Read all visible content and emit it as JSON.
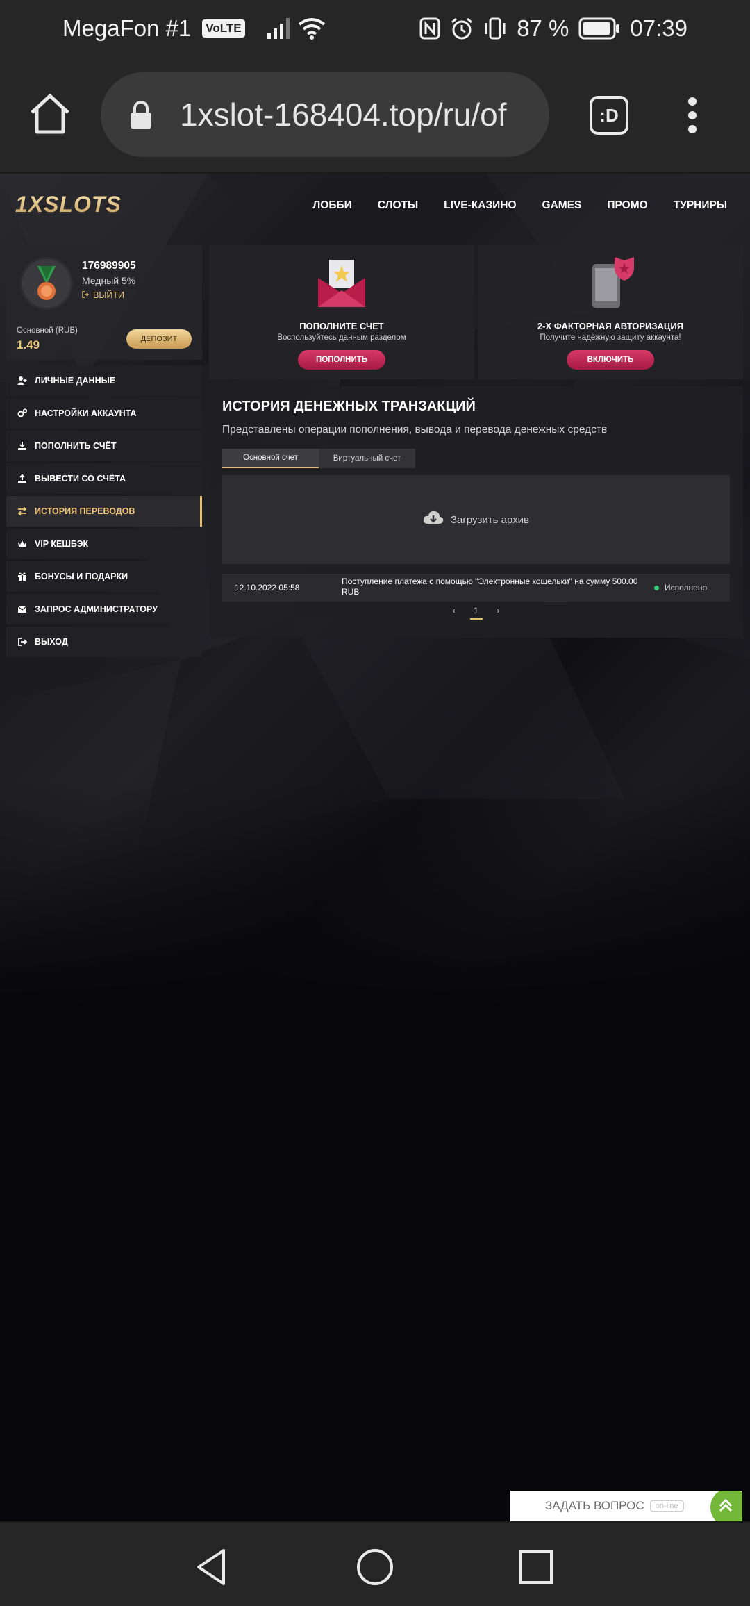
{
  "status_bar": {
    "carrier": "MegaFon #1",
    "volte": "VoLTE",
    "battery": "87 %",
    "time": "07:39"
  },
  "browser": {
    "url": "1xslot-168404.top/ru/of",
    "tabs_label": ":D"
  },
  "site": {
    "logo": "1XSLOTS",
    "nav": [
      "ЛОББИ",
      "СЛОТЫ",
      "LIVE-КАЗИНО",
      "GAMES",
      "ПРОМО",
      "ТУРНИРЫ"
    ]
  },
  "profile": {
    "user_id": "176989905",
    "level": "Медный 5%",
    "logout": "ВЫЙТИ",
    "balance_label": "Основной (RUB)",
    "balance": "1.49",
    "deposit": "ДЕПОЗИТ"
  },
  "side_menu": [
    {
      "label": "ЛИЧНЫЕ ДАННЫЕ",
      "icon": "user-plus-icon"
    },
    {
      "label": "НАСТРОЙКИ АККАУНТА",
      "icon": "gears-icon"
    },
    {
      "label": "ПОПОЛНИТЬ СЧЁТ",
      "icon": "download-icon"
    },
    {
      "label": "ВЫВЕСТИ СО СЧЁТА",
      "icon": "upload-icon"
    },
    {
      "label": "ИСТОРИЯ ПЕРЕВОДОВ",
      "icon": "transfer-icon",
      "active": true
    },
    {
      "label": "VIP КЕШБЭК",
      "icon": "crown-icon"
    },
    {
      "label": "БОНУСЫ И ПОДАРКИ",
      "icon": "gift-icon"
    },
    {
      "label": "ЗАПРОС АДМИНИСТРАТОРУ",
      "icon": "envelope-icon"
    },
    {
      "label": "ВЫХОД",
      "icon": "logout-icon"
    }
  ],
  "cards": {
    "deposit": {
      "title": "ПОПОЛНИТЕ СЧЕТ",
      "subtitle": "Воспользуйтесь данным разделом",
      "button": "ПОПОЛНИТЬ"
    },
    "twofa": {
      "title": "2-Х ФАКТОРНАЯ АВТОРИЗАЦИЯ",
      "subtitle": "Получите надёжную защиту аккаунта!",
      "button": "ВКЛЮЧИТЬ"
    }
  },
  "transactions": {
    "title": "ИСТОРИЯ ДЕНЕЖНЫХ ТРАНЗАКЦИЙ",
    "description": "Представлены операции пополнения, вывода и перевода денежных средств",
    "tabs": [
      "Основной счет",
      "Виртуальный счет"
    ],
    "archive": "Загрузить архив",
    "rows": [
      {
        "date": "12.10.2022 05:58",
        "text": "Поступление платежа с помощью \"Электронные кошельки\" на сумму 500.00 RUB",
        "status": "Исполнено"
      }
    ],
    "pager": {
      "prev": "‹",
      "page": "1",
      "next": "›"
    }
  },
  "chat": {
    "label": "ЗАДАТЬ ВОПРОС",
    "online": "on-line"
  },
  "colors": {
    "accent_gold": "#e8bf6f",
    "button_pink": "#c22a56",
    "status_ok": "#2ecf74"
  }
}
